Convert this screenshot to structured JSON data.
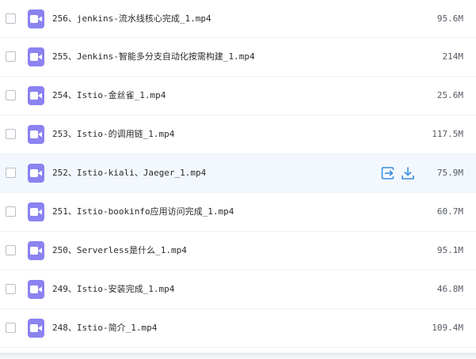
{
  "files": [
    {
      "name": "256、jenkins-流水线核心完成_1.mp4",
      "size": "95.6M"
    },
    {
      "name": "255、Jenkins-智能多分支自动化按需构建_1.mp4",
      "size": "214M"
    },
    {
      "name": "254、Istio-金丝雀_1.mp4",
      "size": "25.6M"
    },
    {
      "name": "253、Istio-的调用链_1.mp4",
      "size": "117.5M"
    },
    {
      "name": "252、Istio-kiali、Jaeger_1.mp4",
      "size": "75.9M"
    },
    {
      "name": "251、Istio-bookinfo应用访问完成_1.mp4",
      "size": "60.7M"
    },
    {
      "name": "250、Serverless是什么_1.mp4",
      "size": "95.1M"
    },
    {
      "name": "249、Istio-安装完成_1.mp4",
      "size": "46.8M"
    },
    {
      "name": "248、Istio-简介_1.mp4",
      "size": "109.4M"
    }
  ],
  "hover_row_index": 4,
  "colors": {
    "video_icon": "#8a83f0",
    "action_icon": "#3b8ede",
    "hover_row": "#f3f8fe"
  },
  "icons": {
    "file": "video-file-icon",
    "share": "share-icon",
    "download": "download-icon"
  }
}
